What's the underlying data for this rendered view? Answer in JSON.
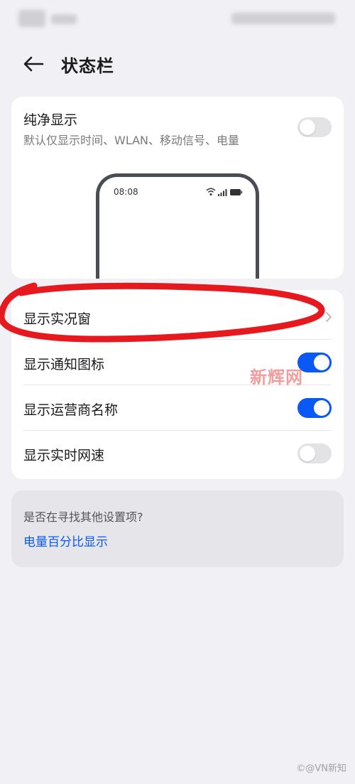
{
  "header": {
    "title": "状态栏",
    "back_icon": "arrow-left-icon"
  },
  "pure_display": {
    "title": "纯净显示",
    "description": "默认仅显示时间、WLAN、移动信号、电量",
    "enabled": false,
    "preview": {
      "time": "08:08",
      "icons": [
        "wifi-icon",
        "signal-icon",
        "battery-icon"
      ]
    }
  },
  "settings": [
    {
      "label": "显示实况窗",
      "control": "chevron",
      "icon": "chevron-right-icon"
    },
    {
      "label": "显示通知图标",
      "control": "toggle",
      "enabled": true
    },
    {
      "label": "显示运营商名称",
      "control": "toggle",
      "enabled": true
    },
    {
      "label": "显示实时网速",
      "control": "toggle",
      "enabled": false
    }
  ],
  "suggestion": {
    "question": "是否在寻找其他设置项?",
    "link": "电量百分比显示"
  },
  "watermark": "新辉网",
  "credit": "©@VN新知",
  "colors": {
    "accent": "#0a59f7",
    "background": "#f1f1f5",
    "card": "#ffffff",
    "annotation": "#e5191e"
  }
}
